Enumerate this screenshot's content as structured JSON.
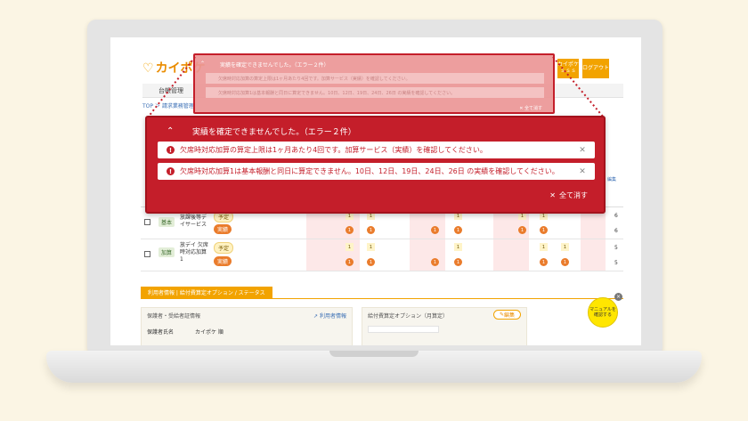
{
  "app": {
    "logo_text": "カイポケ",
    "header_buttons": [
      {
        "label": "カイポケ\nｓｓｓ"
      },
      {
        "label": "ログアウト"
      }
    ],
    "nav_item": "台帳管理",
    "breadcrumb": "TOP ＞ 請求業務管理"
  },
  "colors": {
    "error_red": "#c41e2a",
    "brand_orange": "#f2a300",
    "result_orange": "#ea7c2c",
    "manual_yellow": "#ffe600"
  },
  "error_main": {
    "header": "実績を確定できませんでした。（エラー２件）",
    "messages": [
      "欠席時対応加算の算定上限は1ヶ月あたり4回です。加算サービス（実績）を確認してください。",
      "欠席時対応加算1は基本報酬と同日に算定できません。10日、12日、19日、24日、26日 の実績を確認してください。"
    ],
    "clear_all": "全て消す",
    "collapse_icon": "chevron-up-icon",
    "close_icon": "close-icon"
  },
  "error_background": {
    "header": "実績を確定できませんでした。（エラー２件）",
    "messages": [
      "欠席時対応加算の算定上限は1ヶ月あたり4回です。加算サービス（実績）を確認してください。",
      "欠席時対応加算1は基本報酬と同日に算定できません。10日、12日、19日、24日、26日 の実績を確認してください。"
    ],
    "clear_all": "全て消す"
  },
  "grid": {
    "rows": [
      {
        "tag": "基本",
        "name": "放課後等デ\nイサービス",
        "plan": "予定",
        "result": "実績",
        "total_top": "6",
        "total_bottom": "6"
      },
      {
        "tag": "加算",
        "name": "放デイ 欠席\n時対応加算\n1",
        "plan": "予定",
        "result": "実績",
        "total_top": "5",
        "total_bottom": "5"
      }
    ],
    "mark_value": "1",
    "edit_label": "編集"
  },
  "lower": {
    "section_title": "利用者情報 | 給付費算定オプション / ステータス",
    "left_panel_title": "保護者・受給者証情報",
    "left_panel_link": "利用者情報",
    "left_panel_row": "保護者氏名　　　　カイポケ 順",
    "right_panel_title": "給付費算定オプション（月算定）",
    "right_panel_edit": "編集"
  },
  "manual_button": "マニュアルを\n確認する"
}
